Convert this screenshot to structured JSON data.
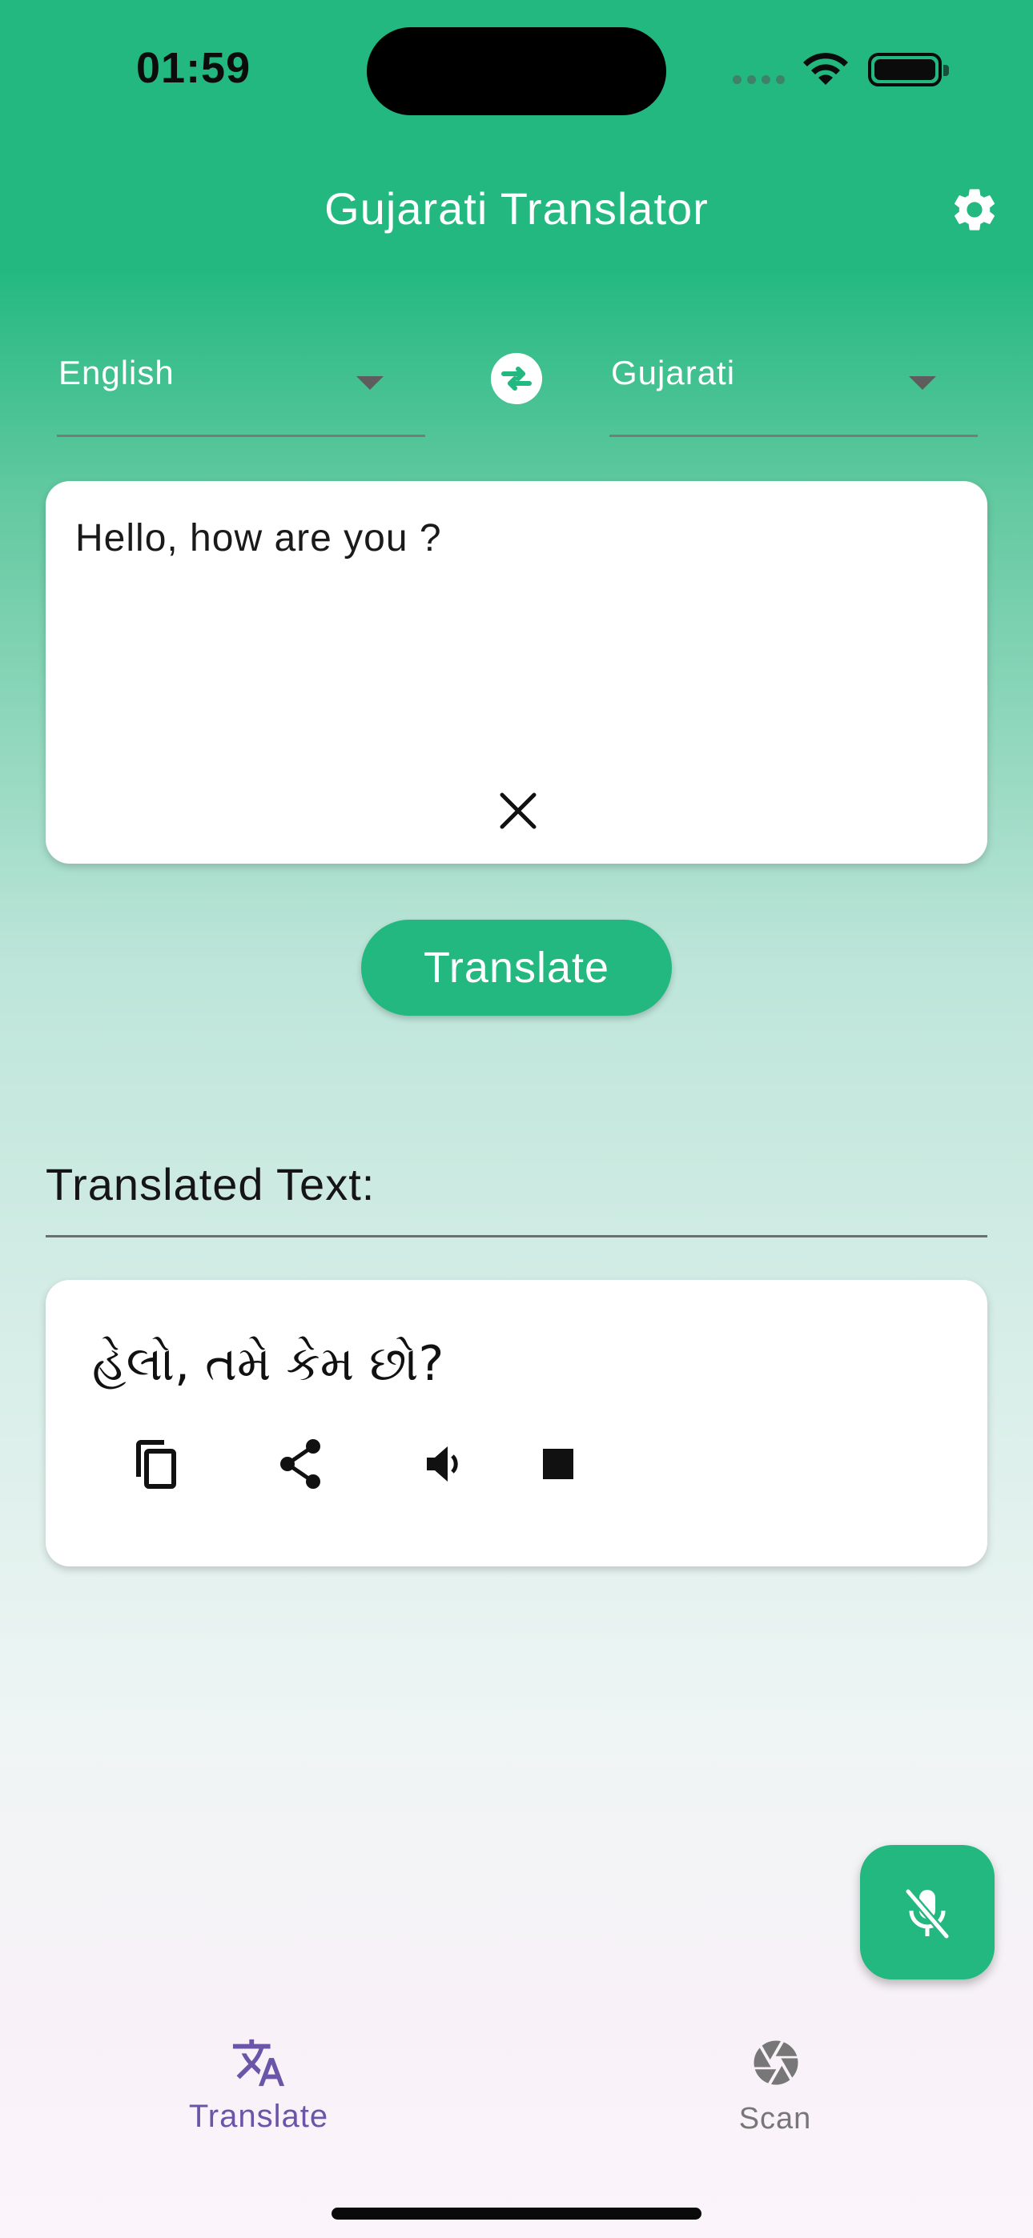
{
  "status_bar": {
    "time": "01:59"
  },
  "app_bar": {
    "title": "Gujarati Translator"
  },
  "languages": {
    "source": "English",
    "target": "Gujarati"
  },
  "input": {
    "text": "Hello, how are you ?"
  },
  "actions": {
    "translate_label": "Translate"
  },
  "output": {
    "section_title": "Translated Text:",
    "text": "હેલો, તમે કેમ છો?"
  },
  "bottom_nav": {
    "items": [
      {
        "label": "Translate",
        "icon": "translate-icon",
        "active": true
      },
      {
        "label": "Scan",
        "icon": "camera-aperture-icon",
        "active": false
      }
    ]
  },
  "colors": {
    "primary": "#22b880",
    "nav_active": "#6a55a8"
  }
}
